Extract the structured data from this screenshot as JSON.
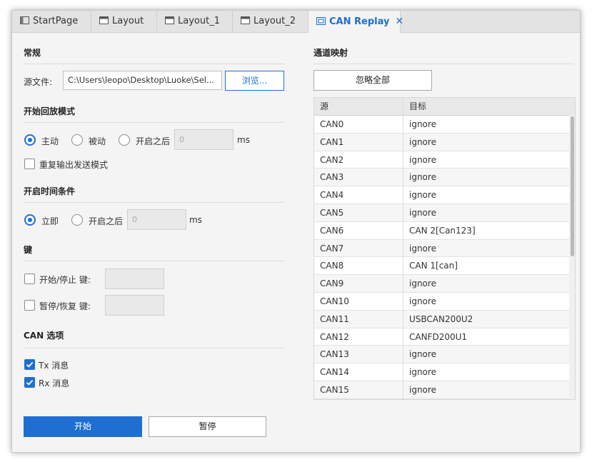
{
  "tabs": [
    {
      "label": "StartPage",
      "icon": "startpage-icon"
    },
    {
      "label": "Layout",
      "icon": "layout-window-icon"
    },
    {
      "label": "Layout_1",
      "icon": "layout-window-icon"
    },
    {
      "label": "Layout_2",
      "icon": "layout-window-icon"
    },
    {
      "label": "CAN Replay",
      "icon": "can-replay-icon",
      "close": "✕"
    }
  ],
  "general": {
    "title": "常规",
    "source_label": "源文件:",
    "source_value": "C:\\Users\\leopo\\Desktop\\Luoke\\Sel...",
    "browse_label": "浏览..."
  },
  "replay_mode": {
    "title": "开始回放模式",
    "options": [
      "主动",
      "被动",
      "开启之后"
    ],
    "selected": "主动",
    "delay_placeholder": "0",
    "unit": "ms",
    "repeat_label": "重复输出发送模式"
  },
  "start_time": {
    "title": "开启时间条件",
    "options": [
      "立即",
      "开启之后"
    ],
    "selected": "立即",
    "delay_placeholder": "0",
    "unit": "ms"
  },
  "keys": {
    "title": "键",
    "start_stop_label": "开始/停止 键:",
    "pause_resume_label": "暂停/恢复 键:"
  },
  "can_options": {
    "title": "CAN 选项",
    "tx_label": "Tx 消息",
    "rx_label": "Rx 消息",
    "tx_checked": true,
    "rx_checked": true
  },
  "actions": {
    "start_label": "开始",
    "pause_label": "暂停"
  },
  "mapping": {
    "title": "通道映射",
    "ignore_all_label": "忽略全部",
    "columns": [
      "源",
      "目标"
    ],
    "rows": [
      [
        "CAN0",
        "ignore"
      ],
      [
        "CAN1",
        "ignore"
      ],
      [
        "CAN2",
        "ignore"
      ],
      [
        "CAN3",
        "ignore"
      ],
      [
        "CAN4",
        "ignore"
      ],
      [
        "CAN5",
        "ignore"
      ],
      [
        "CAN6",
        "CAN 2[Can123]"
      ],
      [
        "CAN7",
        "ignore"
      ],
      [
        "CAN8",
        "CAN 1[can]"
      ],
      [
        "CAN9",
        "ignore"
      ],
      [
        "CAN10",
        "ignore"
      ],
      [
        "CAN11",
        "USBCAN200U2"
      ],
      [
        "CAN12",
        "CANFD200U1"
      ],
      [
        "CAN13",
        "ignore"
      ],
      [
        "CAN14",
        "ignore"
      ],
      [
        "CAN15",
        "ignore"
      ]
    ]
  },
  "colors": {
    "accent": "#1e6fd1",
    "panel": "#f4f4f4",
    "tabbar": "#e3e3e3"
  }
}
